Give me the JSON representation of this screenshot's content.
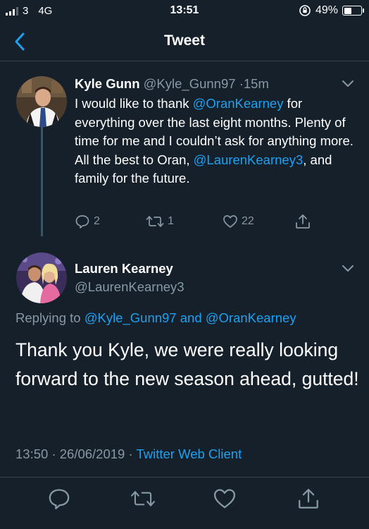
{
  "status_bar": {
    "carrier": "3",
    "network": "4G",
    "time": "13:51",
    "battery_pct": "49%",
    "battery_level": 0.49
  },
  "nav": {
    "title": "Tweet"
  },
  "tweet1": {
    "name": "Kyle Gunn",
    "handle": "@Kyle_Gunn97",
    "sep": "·",
    "time": "15m",
    "text_parts": {
      "p1": "I would like to thank ",
      "mention1": "@OranKearney",
      "p2": " for everything over the last eight months. Plenty of time for me and I couldn’t ask for anything more. All the best to Oran, ",
      "mention2": "@LaurenKearney3",
      "p3": ", and family for the future."
    },
    "replies": "2",
    "retweets": "1",
    "likes": "22"
  },
  "tweet2": {
    "name": "Lauren Kearney",
    "handle": "@LaurenKearney3",
    "replying_prefix": "Replying to ",
    "reply_to1": "@Kyle_Gunn97",
    "reply_and": " and ",
    "reply_to2": "@OranKearney",
    "text": "Thank you Kyle, we were really looking forward to the new season ahead, gutted!",
    "time": "13:50",
    "date": "26/06/2019",
    "dot": "·",
    "client": "Twitter Web Client"
  },
  "colors": {
    "background": "#15202b",
    "accent": "#1da1f2",
    "muted": "#8899a6",
    "divider": "#38444d"
  }
}
